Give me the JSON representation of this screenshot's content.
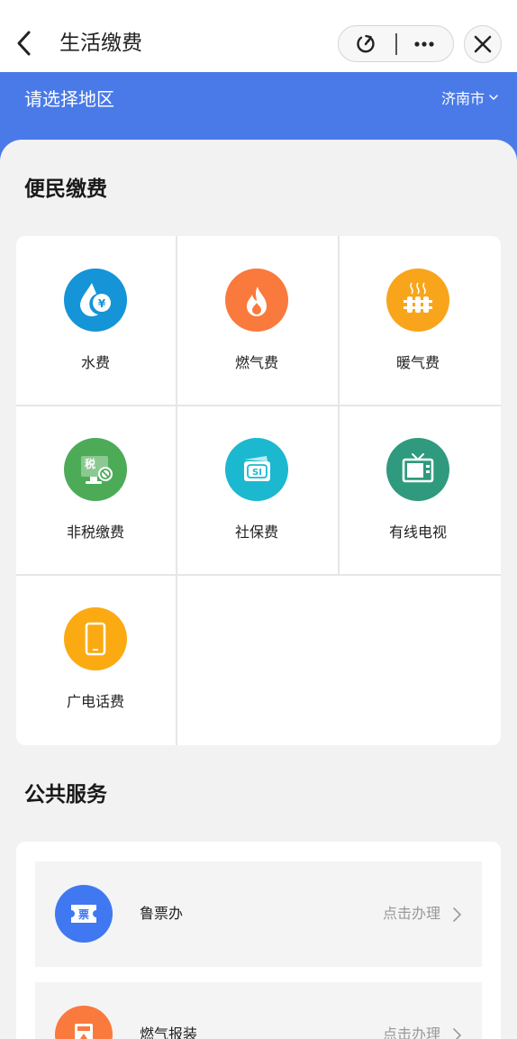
{
  "header": {
    "title": "生活缴费",
    "back_icon": "chevron-left-icon",
    "refresh_icon": "refresh-icon",
    "more_icon": "more-dots-icon",
    "close_icon": "close-icon"
  },
  "region": {
    "title": "请选择地区",
    "city": "济南市",
    "color": "#4a7ae8"
  },
  "convenience": {
    "title": "便民缴费",
    "items": [
      {
        "label": "水费",
        "icon": "water-drop-icon",
        "color": "#1594d8"
      },
      {
        "label": "燃气费",
        "icon": "flame-icon",
        "color": "#f97a3c"
      },
      {
        "label": "暖气费",
        "icon": "radiator-icon",
        "color": "#f8a51c"
      },
      {
        "label": "非税缴费",
        "icon": "tax-monitor-icon",
        "color": "#4dab58"
      },
      {
        "label": "社保费",
        "icon": "social-security-card-icon",
        "color": "#1bb8d0"
      },
      {
        "label": "有线电视",
        "icon": "tv-icon",
        "color": "#2f9a7d"
      },
      {
        "label": "广电话费",
        "icon": "phone-icon",
        "color": "#fbaa12"
      }
    ]
  },
  "public_services": {
    "title": "公共服务",
    "items": [
      {
        "name": "鲁票办",
        "action": "点击办理",
        "icon": "ticket-icon",
        "color": "#3f78f0"
      },
      {
        "name": "燃气报装",
        "action": "点击办理",
        "icon": "gas-install-icon",
        "color": "#f97a3c"
      }
    ]
  }
}
